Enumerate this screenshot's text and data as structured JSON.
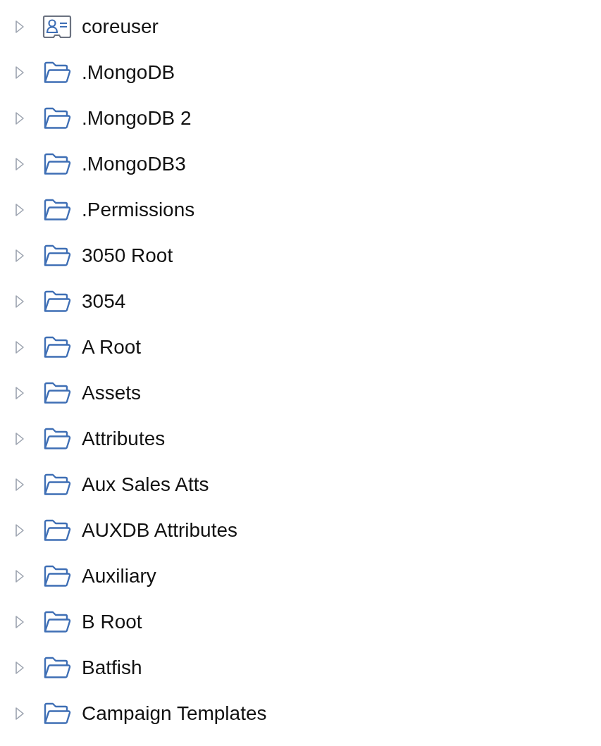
{
  "tree": {
    "items": [
      {
        "label": "coreuser",
        "kind": "account",
        "expanded": false
      },
      {
        "label": ".MongoDB",
        "kind": "folder",
        "expanded": false
      },
      {
        "label": ".MongoDB 2",
        "kind": "folder",
        "expanded": false
      },
      {
        "label": ".MongoDB3",
        "kind": "folder",
        "expanded": false
      },
      {
        "label": ".Permissions",
        "kind": "folder",
        "expanded": false
      },
      {
        "label": "3050 Root",
        "kind": "folder",
        "expanded": false
      },
      {
        "label": "3054",
        "kind": "folder",
        "expanded": false
      },
      {
        "label": "A Root",
        "kind": "folder",
        "expanded": false
      },
      {
        "label": "Assets",
        "kind": "folder",
        "expanded": false
      },
      {
        "label": "Attributes",
        "kind": "folder",
        "expanded": false
      },
      {
        "label": "Aux Sales Atts",
        "kind": "folder",
        "expanded": false
      },
      {
        "label": "AUXDB Attributes",
        "kind": "folder",
        "expanded": false
      },
      {
        "label": "Auxiliary",
        "kind": "folder",
        "expanded": false
      },
      {
        "label": "B Root",
        "kind": "folder",
        "expanded": false
      },
      {
        "label": "Batfish",
        "kind": "folder",
        "expanded": false
      },
      {
        "label": "Campaign Templates",
        "kind": "folder",
        "expanded": false
      }
    ]
  }
}
